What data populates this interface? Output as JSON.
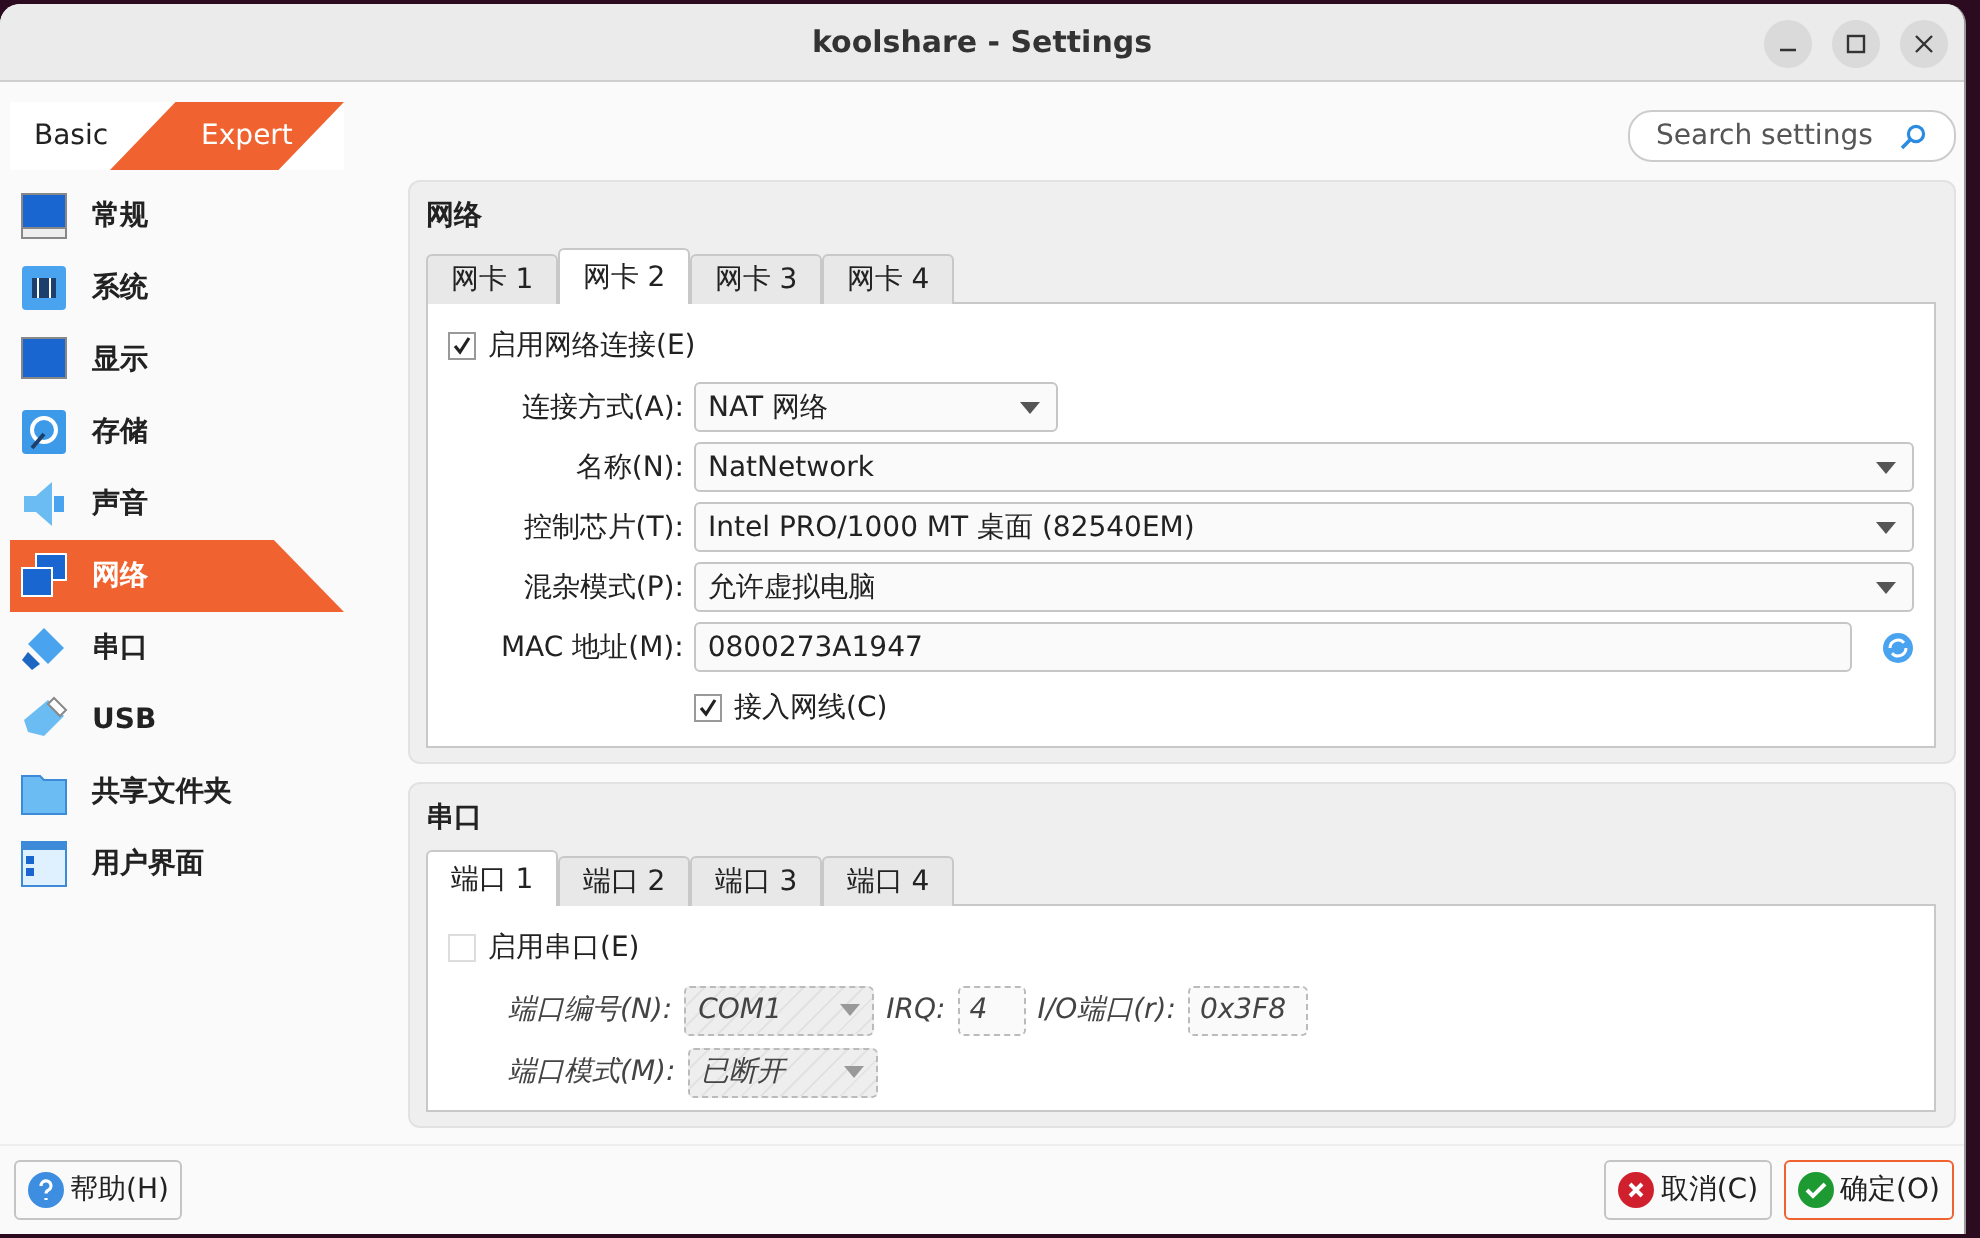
{
  "window": {
    "title": "koolshare - Settings"
  },
  "mode_tabs": [
    {
      "label": "Basic",
      "selected": false
    },
    {
      "label": "Expert",
      "selected": true
    }
  ],
  "search": {
    "placeholder": "Search settings"
  },
  "sidebar": {
    "items": [
      {
        "label": "常规",
        "kind": "general",
        "selected": false
      },
      {
        "label": "系统",
        "kind": "system",
        "selected": false
      },
      {
        "label": "显示",
        "kind": "display",
        "selected": false
      },
      {
        "label": "存储",
        "kind": "storage",
        "selected": false
      },
      {
        "label": "声音",
        "kind": "audio",
        "selected": false
      },
      {
        "label": "网络",
        "kind": "network",
        "selected": true
      },
      {
        "label": "串口",
        "kind": "serial",
        "selected": false
      },
      {
        "label": "USB",
        "kind": "usb",
        "selected": false
      },
      {
        "label": "共享文件夹",
        "kind": "folder",
        "selected": false
      },
      {
        "label": "用户界面",
        "kind": "ui",
        "selected": false
      }
    ]
  },
  "network": {
    "title": "网络",
    "tabs": [
      {
        "label": "网卡 1",
        "selected": false
      },
      {
        "label": "网卡 2",
        "selected": true
      },
      {
        "label": "网卡 3",
        "selected": false
      },
      {
        "label": "网卡 4",
        "selected": false
      }
    ],
    "enable": {
      "label": "启用网络连接(E)",
      "checked": true
    },
    "fields": [
      {
        "label": "连接方式(A):",
        "value": "NAT 网络",
        "kind": "combo-short"
      },
      {
        "label": "名称(N):",
        "value": "NatNetwork",
        "kind": "combo"
      },
      {
        "label": "控制芯片(T):",
        "value": "Intel PRO/1000 MT 桌面 (82540EM)",
        "kind": "combo"
      },
      {
        "label": "混杂模式(P):",
        "value": "允许虚拟电脑",
        "kind": "combo"
      },
      {
        "label": "MAC 地址(M):",
        "value": "0800273A1947",
        "kind": "mac"
      }
    ],
    "cable": {
      "label": "接入网线(C)",
      "checked": true
    }
  },
  "serial": {
    "title": "串口",
    "tabs": [
      {
        "label": "端口 1",
        "selected": true
      },
      {
        "label": "端口 2",
        "selected": false
      },
      {
        "label": "端口 3",
        "selected": false
      },
      {
        "label": "端口 4",
        "selected": false
      }
    ],
    "enable": {
      "label": "启用串口(E)",
      "checked": false
    },
    "rows": [
      [
        {
          "kind": "label",
          "text": "端口编号(N):"
        },
        {
          "kind": "combo",
          "text": "COM1"
        },
        {
          "kind": "label",
          "text": "IRQ:"
        },
        {
          "kind": "text",
          "text": "4"
        },
        {
          "kind": "label",
          "text": "I/O端口(r):"
        },
        {
          "kind": "text",
          "text": "0x3F8"
        }
      ],
      [
        {
          "kind": "label",
          "text": "端口模式(M):"
        },
        {
          "kind": "combo",
          "text": "已断开"
        }
      ]
    ]
  },
  "buttons": [
    {
      "label": "帮助(H)",
      "kind": "help",
      "focused": false
    },
    {
      "label": "取消(C)",
      "kind": "cancel",
      "focused": false
    },
    {
      "label": "确定(O)",
      "kind": "ok",
      "focused": true
    }
  ]
}
